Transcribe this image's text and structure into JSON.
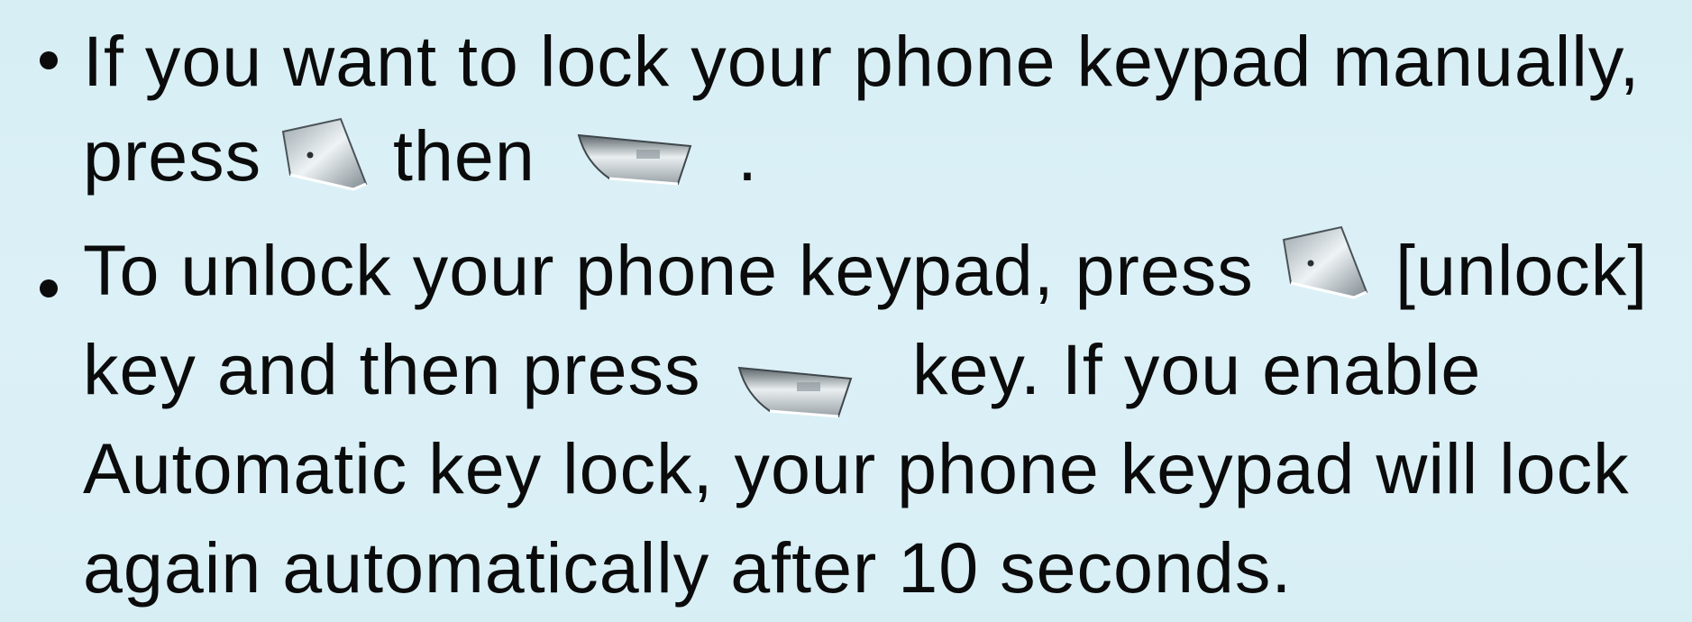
{
  "bullets": [
    {
      "line1": "If you want to lock your phone keypad manually,",
      "line2_a": "press",
      "line2_b": "then",
      "line2_c": ".",
      "icons": [
        "end-key-icon",
        "left-soft-key-icon"
      ]
    },
    {
      "line1_a": "To unlock your phone keypad, press",
      "line1_b": "[unlock]",
      "line2_a": "key and then press",
      "line2_b": "key. If you enable",
      "line3": "Automatic key lock, your phone keypad will lock",
      "line4": "again automatically after 10 seconds.",
      "icons": [
        "end-key-icon",
        "left-soft-key-icon"
      ]
    }
  ],
  "colors": {
    "background": "#d9f0f6",
    "text": "#0b0b0b"
  }
}
